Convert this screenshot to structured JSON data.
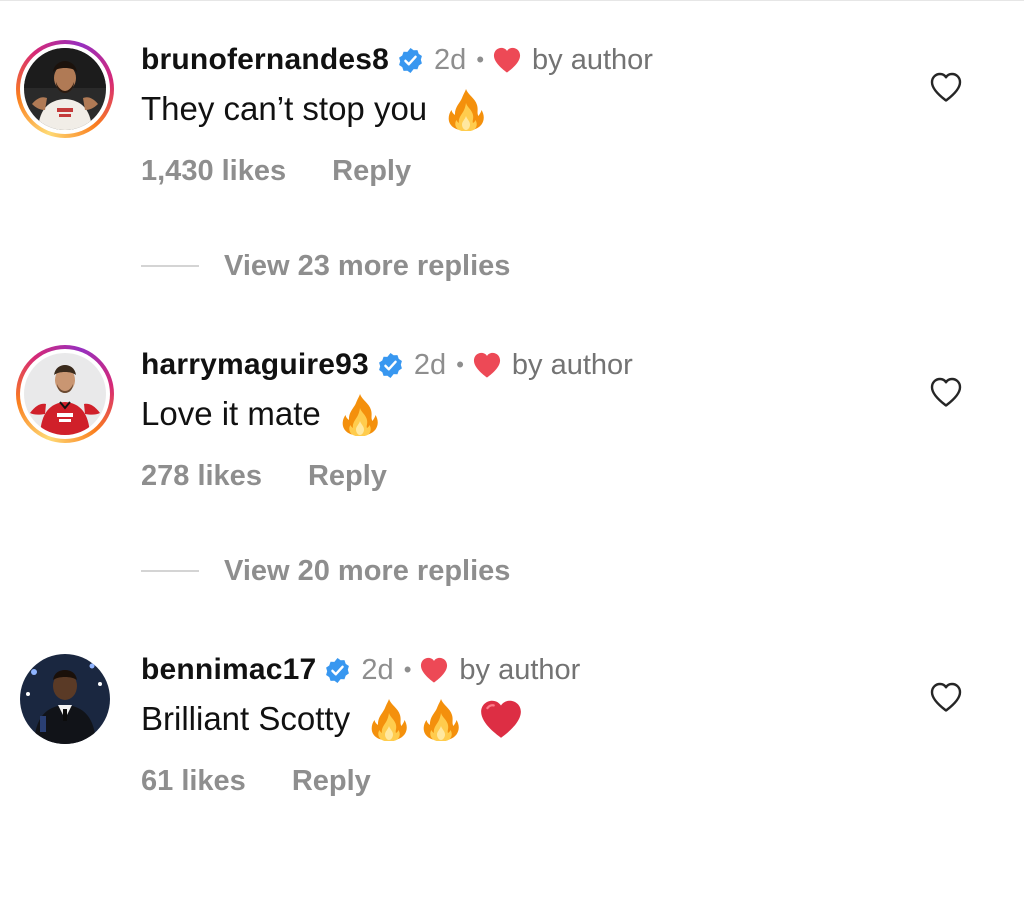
{
  "comments": [
    {
      "username": "brunofernandes8",
      "time": "2d",
      "dot": "•",
      "by_author": "by author",
      "text": "They can’t stop you",
      "likes": "1,430 likes",
      "reply_label": "Reply",
      "view_replies": "View 23 more replies",
      "emojis": [
        "fire"
      ],
      "has_story_ring": true
    },
    {
      "username": "harrymaguire93",
      "time": "2d",
      "dot": "•",
      "by_author": "by author",
      "text": "Love it mate",
      "likes": "278 likes",
      "reply_label": "Reply",
      "view_replies": "View 20 more replies",
      "emojis": [
        "fire"
      ],
      "has_story_ring": true
    },
    {
      "username": "bennimac17",
      "time": "2d",
      "dot": "•",
      "by_author": "by author",
      "text": "Brilliant Scotty",
      "likes": "61 likes",
      "reply_label": "Reply",
      "emojis": [
        "fire",
        "fire",
        "red-heart"
      ],
      "has_story_ring": false
    }
  ],
  "colors": {
    "verified_blue": "#3897f0",
    "heart_red": "#ed4956",
    "secondary_text": "#8e8e8e"
  }
}
